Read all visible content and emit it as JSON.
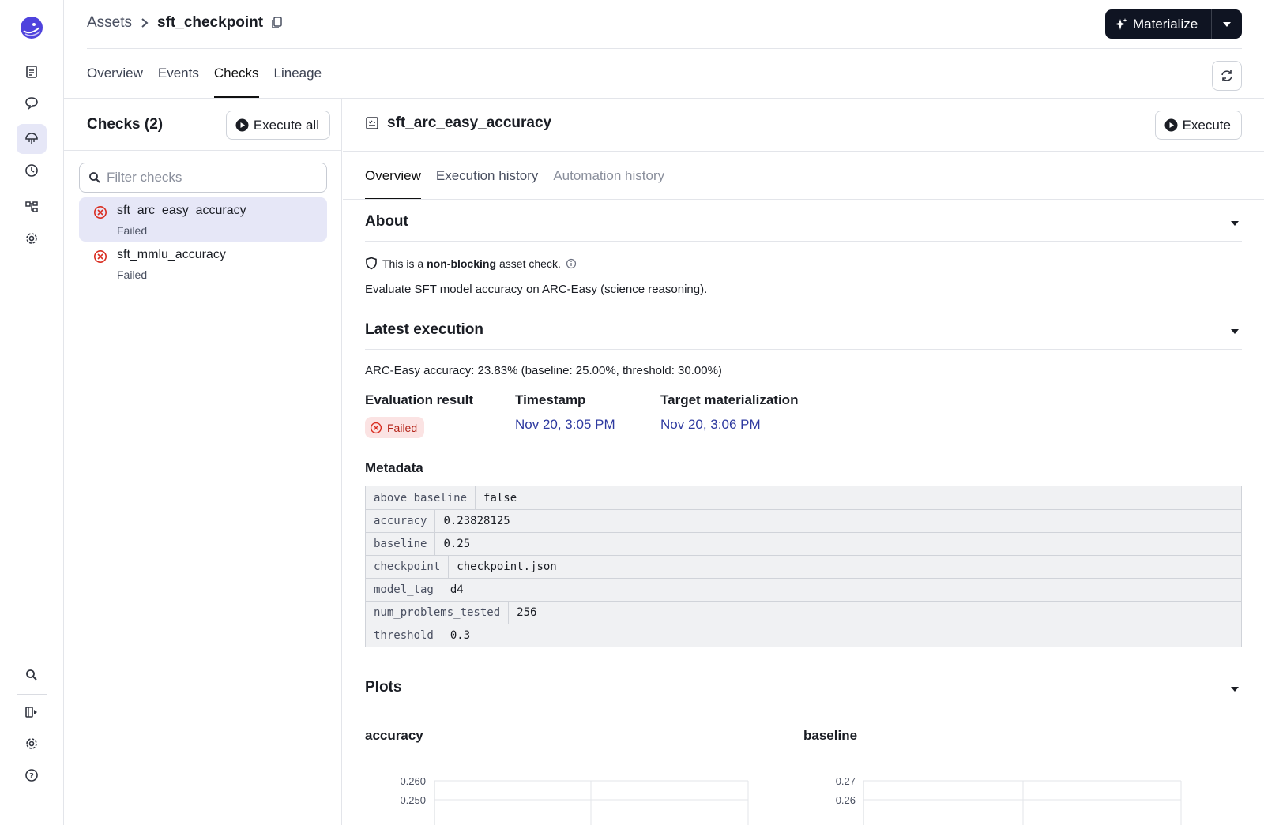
{
  "breadcrumb": {
    "root": "Assets",
    "current": "sft_checkpoint"
  },
  "header": {
    "materialize_label": "Materialize"
  },
  "tabs": [
    {
      "label": "Overview"
    },
    {
      "label": "Events"
    },
    {
      "label": "Checks",
      "active": true
    },
    {
      "label": "Lineage"
    }
  ],
  "checks_panel": {
    "title": "Checks (2)",
    "execute_all_label": "Execute all",
    "filter_placeholder": "Filter checks",
    "items": [
      {
        "name": "sft_arc_easy_accuracy",
        "status": "Failed",
        "selected": true
      },
      {
        "name": "sft_mmlu_accuracy",
        "status": "Failed",
        "selected": false
      }
    ]
  },
  "detail": {
    "title": "sft_arc_easy_accuracy",
    "execute_label": "Execute",
    "tabs": [
      {
        "label": "Overview",
        "active": true
      },
      {
        "label": "Execution history"
      },
      {
        "label": "Automation history"
      }
    ],
    "about": {
      "heading": "About",
      "blocking_prefix": "This is a",
      "blocking_bold": "non-blocking",
      "blocking_suffix": "asset check.",
      "description": "Evaluate SFT model accuracy on ARC-Easy (science reasoning)."
    },
    "latest_execution": {
      "heading": "Latest execution",
      "summary": "ARC-Easy accuracy: 23.83% (baseline: 25.00%, threshold: 30.00%)",
      "evaluation_result_label": "Evaluation result",
      "evaluation_result": "Failed",
      "timestamp_label": "Timestamp",
      "timestamp": "Nov 20, 3:05 PM",
      "target_label": "Target materialization",
      "target": "Nov 20, 3:06 PM"
    },
    "metadata": {
      "heading": "Metadata",
      "rows": [
        {
          "key": "above_baseline",
          "value": "false"
        },
        {
          "key": "accuracy",
          "value": "0.23828125"
        },
        {
          "key": "baseline",
          "value": "0.25"
        },
        {
          "key": "checkpoint",
          "value": "checkpoint.json"
        },
        {
          "key": "model_tag",
          "value": "d4"
        },
        {
          "key": "num_problems_tested",
          "value": "256"
        },
        {
          "key": "threshold",
          "value": "0.3"
        }
      ]
    },
    "plots": {
      "heading": "Plots",
      "accuracy_title": "accuracy",
      "baseline_title": "baseline"
    }
  },
  "chart_data": [
    {
      "type": "line",
      "title": "accuracy",
      "y_ticks": [
        "0.260",
        "0.250"
      ]
    },
    {
      "type": "line",
      "title": "baseline",
      "y_ticks": [
        "0.27",
        "0.26"
      ]
    }
  ],
  "colors": {
    "accent": "#2e3aa0",
    "failed": "#b42318",
    "selected_bg": "#e6e7f7",
    "dark_button": "#0f1422"
  }
}
